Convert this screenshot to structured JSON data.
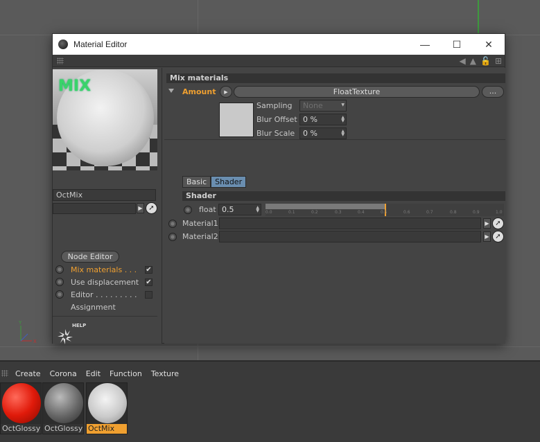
{
  "window": {
    "title": "Material Editor",
    "minimize": "—",
    "maximize": "☐",
    "close": "✕"
  },
  "preview": {
    "overlay_label": "MIX"
  },
  "left": {
    "material_name": "OctMix",
    "node_editor_label": "Node Editor",
    "channels": [
      {
        "label": "Mix materials . . .",
        "checked": true,
        "active": true
      },
      {
        "label": "Use displacement",
        "checked": true,
        "active": false
      },
      {
        "label": "Editor . . . . . . . . .",
        "checked": false,
        "active": false
      },
      {
        "label": "Assignment",
        "checked": false,
        "active": false
      }
    ],
    "help_label": "HELP"
  },
  "right": {
    "section_title": "Mix materials",
    "amount_label": "Amount",
    "shader_name": "FloatTexture",
    "dots_label": "...",
    "sampling_label": "Sampling",
    "sampling_value": "None",
    "blur_offset_label": "Blur Offset",
    "blur_offset_value": "0 %",
    "blur_scale_label": "Blur Scale",
    "blur_scale_value": "0 %",
    "tabs": [
      {
        "label": "Basic",
        "active": false
      },
      {
        "label": "Shader",
        "active": true
      }
    ],
    "shader_section": "Shader",
    "float_label": "float",
    "float_value": "0.5",
    "float_fraction": 0.5,
    "slider_ticks": [
      "0.0",
      "0.1",
      "0.2",
      "0.3",
      "0.4",
      "0.5",
      "0.6",
      "0.7",
      "0.8",
      "0.9",
      "1.0"
    ],
    "material1_label": "Material1",
    "material2_label": "Material2"
  },
  "bottom": {
    "menu": [
      "Create",
      "Corona",
      "Edit",
      "Function",
      "Texture"
    ],
    "materials": [
      {
        "name": "OctGlossy",
        "style": "red",
        "selected": false
      },
      {
        "name": "OctGlossy",
        "style": "chk",
        "selected": false
      },
      {
        "name": "OctMix",
        "style": "white",
        "selected": true
      }
    ]
  },
  "colors": {
    "accent_orange": "#f0a030",
    "active_tab": "#6a8eb0",
    "mix_green": "#3ad36a"
  }
}
